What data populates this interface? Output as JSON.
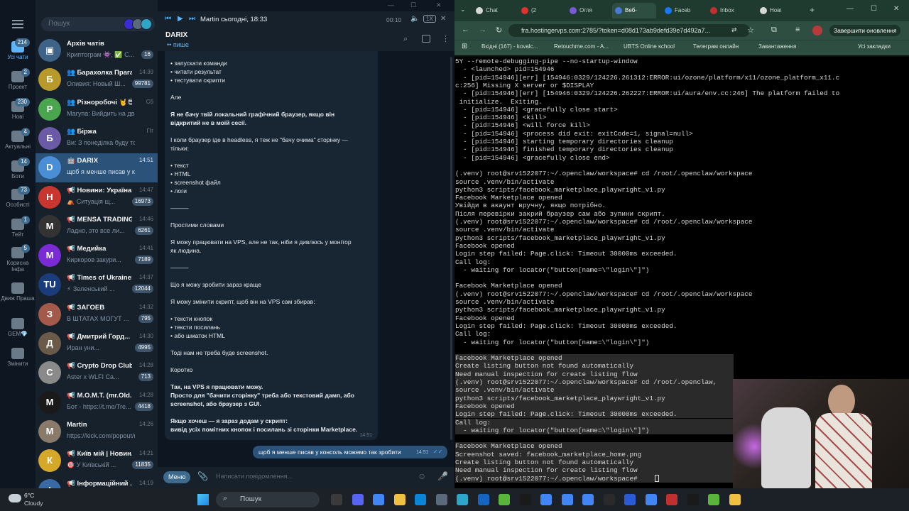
{
  "telegram": {
    "folders": [
      {
        "label": "Усі чати",
        "badge": "214"
      },
      {
        "label": "Проект",
        "badge": "2"
      },
      {
        "label": "Нові",
        "badge": "230"
      },
      {
        "label": "Актуальні",
        "badge": "4"
      },
      {
        "label": "Боти",
        "badge": "14"
      },
      {
        "label": "Особисті",
        "badge": "73"
      },
      {
        "label": "Тейт",
        "badge": "1"
      },
      {
        "label": "Корисна Інфа",
        "badge": "5"
      },
      {
        "label": "Движ Праша",
        "badge": ""
      },
      {
        "label": "GEM💎",
        "badge": ""
      },
      {
        "label": "Змінити",
        "badge": ""
      }
    ],
    "search_placeholder": "Пошук",
    "chats": [
      {
        "name": "Архів чатів",
        "preview": "Криптограм 👾, ✅ С...",
        "time": "",
        "count": "16",
        "color": "#3f6386",
        "initial": "▣"
      },
      {
        "name": "👥 Барахолка Прага...",
        "preview": "Оливия: Новый Ш...",
        "time": "14:39",
        "count": "99781",
        "color": "#b79a2a",
        "initial": "Б"
      },
      {
        "name": "👥 Різноробочі 🤘😎...",
        "preview": "Магупа: Вийдить на двір",
        "time": "Сб",
        "count": "",
        "color": "#4aa64e",
        "initial": "Р"
      },
      {
        "name": "👥 Біржа",
        "preview": "Ви: З понеділка буду то...",
        "time": "Пт",
        "count": "",
        "color": "#6b5aa6",
        "initial": "Б"
      },
      {
        "name": "🤖 DARIX",
        "preview": "щоб я менше писав у конс...",
        "time": "14:51",
        "count": "",
        "color": "#4a8fd6",
        "initial": "D"
      },
      {
        "name": "📢 Новини: Україна ...",
        "preview": "⛺ Ситуація щ...",
        "time": "14:47",
        "count": "16973",
        "color": "#c8372f",
        "initial": "Н"
      },
      {
        "name": "📢 MENSA TRADING",
        "preview": "Ладно, это все ли...",
        "time": "14:46",
        "count": "6261",
        "color": "#333333",
        "initial": "M"
      },
      {
        "name": "📢 Медийка",
        "preview": "Киркоров закури...",
        "time": "14:41",
        "count": "7189",
        "color": "#7a2bd6",
        "initial": "M"
      },
      {
        "name": "📢 Times of Ukraine: ...",
        "preview": "⚡ Зеленський ...",
        "time": "14:37",
        "count": "12044",
        "color": "#1a3c7a",
        "initial": "TU"
      },
      {
        "name": "📢 ЗАГОЕВ",
        "preview": "В ШТАТАХ МОГУТ ...",
        "time": "14:32",
        "count": "795",
        "color": "#a35a4a",
        "initial": "З"
      },
      {
        "name": "📢 Дмитрий Горд... ✔",
        "preview": "Иран уни...",
        "time": "14:30",
        "count": "4995",
        "color": "#6a5a4a",
        "initial": "Д"
      },
      {
        "name": "📢 Crypto Drop Club",
        "preview": "Aster x WLFI Ca...",
        "time": "14:28",
        "count": "713",
        "color": "#8a8a8a",
        "initial": "C"
      },
      {
        "name": "📢 M.O.M.T. (mr.Old...",
        "preview": "Бот - https://t.me/Tre...",
        "time": "14:28",
        "count": "4418",
        "color": "#1a1a1a",
        "initial": "M"
      },
      {
        "name": "Martin",
        "preview": "https://kick.com/popout/mr...",
        "time": "14:26",
        "count": "",
        "color": "#8a7a6a",
        "initial": "M"
      },
      {
        "name": "📢 Київ мій | Новин...",
        "preview": "🎯 У Київській ...",
        "time": "14:21",
        "count": "11835",
        "color": "#d6a82a",
        "initial": "К"
      },
      {
        "name": "📢 Інформаційний ...",
        "preview": "",
        "time": "14:19",
        "count": "",
        "color": "#3a6aa6",
        "initial": "І"
      }
    ],
    "player": {
      "title": "Martin сьогодні, 18:33",
      "time": "00:10",
      "speed": "1X"
    },
    "conversation": {
      "name": "DARIX",
      "status": "пише",
      "lines": [
        "• запускати команди",
        "• читати результат",
        "• тестувати скрипти",
        "Але",
        "Я не бачу твій локальний графічний браузер, якщо він",
        "відкритий не в моїй сесії.",
        "І коли браузер іде в headless, я теж не \"бачу очима\" сторінку —",
        "тільки:",
        "• текст",
        "• HTML",
        "• screenshot файл",
        "• логи",
        "———",
        "Простими словами",
        "Я можу працювати на VPS, але не так, ніби я дивлюсь у монітор",
        "як людина.",
        "———",
        "Що я можу зробити зараз краще",
        "Я можу змінити скрипт, щоб він на VPS сам збирав:",
        "• тексти кнопок",
        "• тексти посилань",
        "• або шматок HTML",
        "Тоді нам не треба буде screenshot.",
        "Коротко",
        "Так, на VPS я працювати можу.",
        "Просто для \"бачити сторінку\" треба або текстовий дамп, або",
        "screenshot, або браузер з GUI.",
        "Якщо хочеш — я зараз додам у скрипт:",
        "вивід усіх помітних кнопок і посилань зі сторінки Marketplace."
      ],
      "bubble_time": "14:51",
      "outgoing": "щоб я менше писав у консоль можемо так зробити",
      "outgoing_time": "14:51",
      "menu_label": "Меню",
      "input_placeholder": "Написати повідомлення..."
    }
  },
  "browser": {
    "tabs": [
      "Chat",
      "(2",
      "Огля",
      "Веб-",
      "Faceb",
      "Inbox",
      "Нові"
    ],
    "url": "fra.hostingervps.com:2785/?token=d08d173ab9defd39e7d492a7...",
    "profile_button": "Завершити оновлення",
    "bookmarks": [
      "Вхідні (167) - kovalc...",
      "Retouchme.com - A...",
      "UBTS Online school",
      "Телеграм онлайн",
      "Завантаження",
      "Усі закладки"
    ]
  },
  "terminal": [
    "5Y --remote-debugging-pipe --no-startup-window",
    "  - <launched> pid=154946",
    "  - [pid=154946][err] [154946:0329/124226.261312:ERROR:ui/ozone/platform/x11/ozone_platform_x11.c",
    "c:256] Missing X server or $DISPLAY",
    "  - [pid=154946][err] [154946:0329/124226.262227:ERROR:ui/aura/env.cc:246] The platform failed to",
    " initialize.  Exiting.",
    "  - [pid=154946] <gracefully close start>",
    "  - [pid=154946] <kill>",
    "  - [pid=154946] <will force kill>",
    "  - [pid=154946] <process did exit: exitCode=1, signal=null>",
    "  - [pid=154946] starting temporary directories cleanup",
    "  - [pid=154946] finished temporary directories cleanup",
    "  - [pid=154946] <gracefully close end>",
    "",
    "(.venv) root@srv1522077:~/.openclaw/workspace# cd /root/.openclaw/workspace",
    "source .venv/bin/activate",
    "python3 scripts/facebook_marketplace_playwright_v1.py",
    "Facebook Marketplace opened",
    "Увійди в акаунт вручну, якщо потрібно.",
    "Після перевірки закрий браузер сам або зупини скрипт.",
    "(.venv) root@srv1522077:~/.openclaw/workspace# cd /root/.openclaw/workspace",
    "source .venv/bin/activate",
    "python3 scripts/facebook_marketplace_playwright_v1.py",
    "Facebook opened",
    "Login step failed: Page.click: Timeout 30000ms exceeded.",
    "Call log:",
    "  - waiting for locator(\"button[name=\\\"login\\\"]\")",
    "",
    "Facebook Marketplace opened",
    "(.venv) root@srv1522077:~/.openclaw/workspace# cd /root/.openclaw/workspace",
    "source .venv/bin/activate",
    "python3 scripts/facebook_marketplace_playwright_v1.py",
    "Facebook opened",
    "Login step failed: Page.click: Timeout 30000ms exceeded.",
    "Call log:",
    "  - waiting for locator(\"button[name=\\\"login\\\"]\")",
    "",
    "Facebook Marketplace opened",
    "Create listing button not found automatically",
    "Need manual inspection for create listing flow",
    "(.venv) root@srv1522077:~/.openclaw/workspace# cd /root/.openclaw,",
    "source .venv/bin/activate",
    "python3 scripts/facebook_marketplace_playwright_v1.py",
    "Facebook opened",
    "Login step failed: Page.click: Timeout 30000ms exceeded.",
    "Call log:",
    "  - waiting for locator(\"button[name=\\\"login\\\"]\")",
    "",
    "Facebook Marketplace opened",
    "Screenshot saved: facebook_marketplace_home.png",
    "Create listing button not found automatically",
    "Need manual inspection for create listing flow",
    "(.venv) root@srv1522077:~/.openclaw/workspace# "
  ],
  "taskbar": {
    "weather_temp": "6°C",
    "weather_desc": "Cloudy",
    "search_label": "Пошук"
  }
}
